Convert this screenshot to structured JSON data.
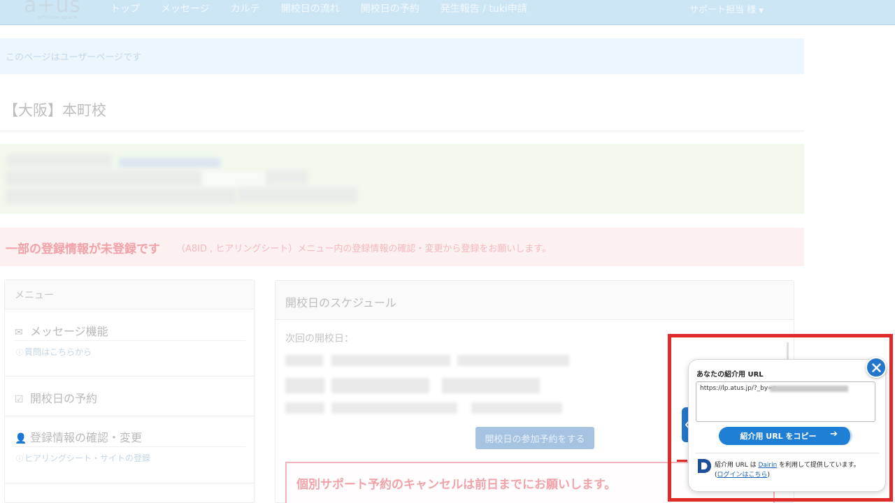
{
  "nav": {
    "logo": "a+us",
    "logo_sub": "affiliate space",
    "items": [
      "トップ",
      "メッセージ",
      "カルテ",
      "開校日の流れ",
      "開校日の予約",
      "発生報告 / tuki申請"
    ],
    "user": "サポート担当 様"
  },
  "alerts": {
    "info": "このページはユーザーページです",
    "danger_strong": "一部の登録情報が未登録です",
    "danger_rest": "（A8ID , ヒアリングシート）メニュー内の登録情報の確認・変更から登録をお願いします。"
  },
  "school_title": "【大阪】本町校",
  "menu": {
    "heading": "メニュー",
    "items": [
      {
        "title": "メッセージ機能",
        "sub": "質問はこちらから",
        "icon": "envelope-icon"
      },
      {
        "title": "開校日の予約",
        "sub": "",
        "icon": "calendar-check-icon"
      },
      {
        "title": "登録情報の確認・変更",
        "sub": "ヒアリングシート・サイトの登録",
        "icon": "user-edit-icon"
      }
    ]
  },
  "schedule": {
    "heading": "開校日のスケジュール",
    "next_label": "次回の開校日：",
    "reserve_button": "開校日の参加予約をする",
    "cancel_notice": "個別サポート予約のキャンセルは前日までにお願いします。"
  },
  "popup": {
    "title": "あなたの紹介用 URL",
    "url_value": "https://lp.atus.jp/?_by=r",
    "copy_button": "紹介用 URL をコピー",
    "footer_pre": "紹介用 URL は ",
    "footer_link": "Dairin",
    "footer_post": " を利用して提供しています。",
    "login_link": "ログインはこちら"
  },
  "colors": {
    "navbar": "#cde6f6",
    "popup_accent": "#2376c9",
    "highlight": "#e02a2a"
  }
}
